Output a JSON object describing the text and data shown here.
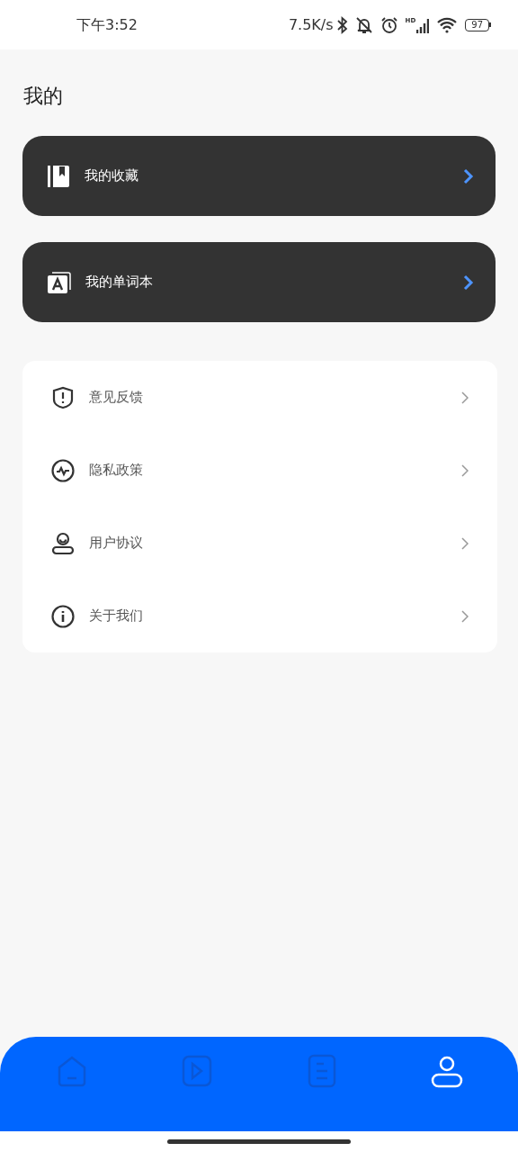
{
  "status_bar": {
    "time": "下午3:52",
    "net_speed": "7.5K/s",
    "signal_label": "HD",
    "battery": "97"
  },
  "title": "我的",
  "feature_cards": [
    {
      "kind": "bookmark",
      "label": "我的收藏"
    },
    {
      "kind": "vocab",
      "label": "我的单词本"
    }
  ],
  "menu": [
    {
      "kind": "feedback",
      "label": "意见反馈"
    },
    {
      "kind": "privacy",
      "label": "隐私政策"
    },
    {
      "kind": "user",
      "label": "用户协议"
    },
    {
      "kind": "about",
      "label": "关于我们"
    }
  ],
  "tabs": [
    {
      "kind": "home",
      "selected": false
    },
    {
      "kind": "video",
      "selected": false
    },
    {
      "kind": "list",
      "selected": false
    },
    {
      "kind": "profile",
      "selected": true
    }
  ]
}
